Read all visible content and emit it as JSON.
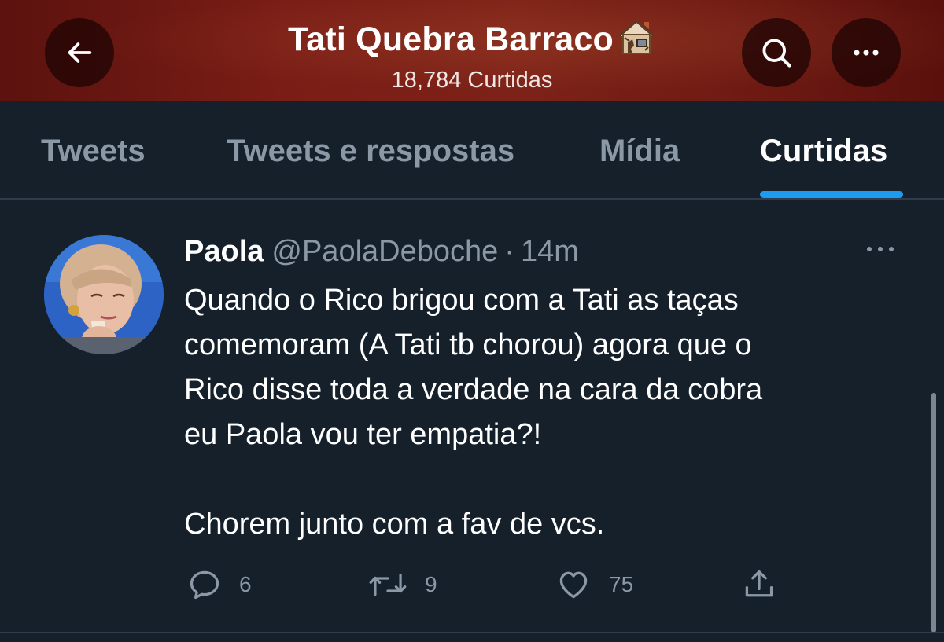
{
  "header": {
    "title": "Tati Quebra Barraco",
    "emoji": "house-emoji",
    "subtitle": "18,784 Curtidas",
    "back_icon": "arrow-left-icon",
    "search_icon": "search-icon",
    "more_icon": "more-horizontal-icon"
  },
  "tabs": [
    {
      "label": "Tweets",
      "active": false
    },
    {
      "label": "Tweets e respostas",
      "active": false
    },
    {
      "label": "Mídia",
      "active": false
    },
    {
      "label": "Curtidas",
      "active": true
    }
  ],
  "tweet": {
    "author_name": "Paola",
    "handle": "@PaolaDeboche",
    "separator": "·",
    "time": "14m",
    "lines": [
      "Quando o Rico brigou com a Tati as taças",
      "comemoram (A Tati tb chorou) agora que o",
      "Rico disse toda a verdade na cara da cobra",
      "eu Paola vou ter empatia?!"
    ],
    "closing_line": "Chorem junto com a fav de vcs.",
    "actions": {
      "replies": "6",
      "retweets": "9",
      "likes": "75"
    }
  },
  "colors": {
    "background": "#15202b",
    "header": "#7a1d16",
    "accent": "#1d9bf0",
    "muted_text": "#8b98a5",
    "divider": "#2f3d4a"
  }
}
